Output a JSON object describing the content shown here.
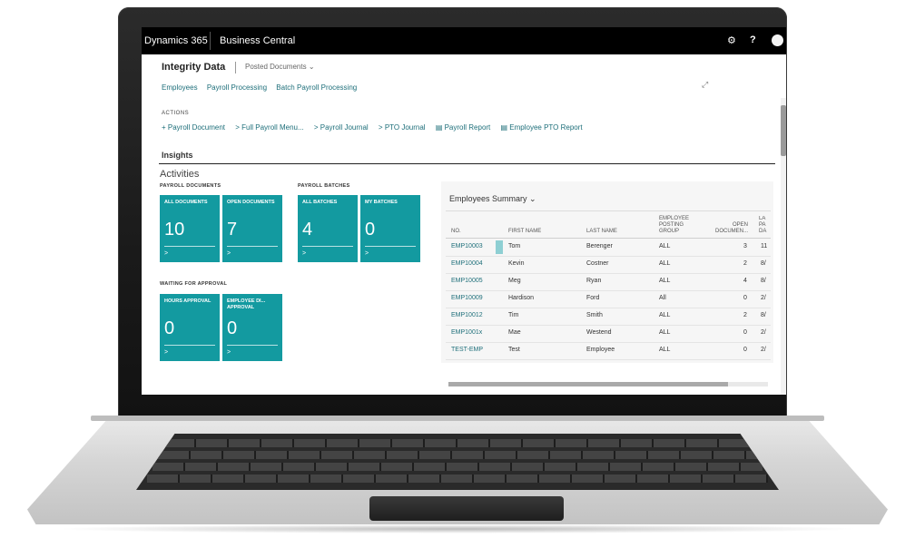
{
  "app": {
    "brand": "Dynamics 365",
    "product": "Business Central",
    "settings_icon": "⚙",
    "help_icon": "?"
  },
  "page": {
    "company": "Integrity Data",
    "menu_selector": "Posted Documents",
    "nav_links": [
      "Employees",
      "Payroll Processing",
      "Batch Payroll Processing"
    ],
    "actions_header": "ACTIONS",
    "actions": [
      "+ Payroll Document",
      "> Full Payroll Menu...",
      "> Payroll Journal",
      "> PTO Journal",
      "▤ Payroll Report",
      "▤ Employee PTO Report"
    ],
    "insights": "Insights",
    "activities": "Activities"
  },
  "tile_groups": [
    {
      "label": "PAYROLL DOCUMENTS",
      "tiles": [
        {
          "label": "ALL DOCUMENTS",
          "value": "10"
        },
        {
          "label": "OPEN DOCUMENTS",
          "value": "7"
        }
      ]
    },
    {
      "label": "PAYROLL BATCHES",
      "tiles": [
        {
          "label": "ALL BATCHES",
          "value": "4"
        },
        {
          "label": "MY BATCHES",
          "value": "0"
        }
      ]
    },
    {
      "label": "WAITING FOR APPROVAL",
      "tiles": [
        {
          "label": "HOURS APPROVAL",
          "value": "0"
        },
        {
          "label": "EMPLOYEE DI... APPROVAL",
          "value": "0"
        }
      ]
    }
  ],
  "tile_arrow": ">",
  "employees_summary": {
    "title": "Employees Summary",
    "columns": [
      "NO.",
      "FIRST NAME",
      "LAST NAME",
      "EMPLOYEE POSTING GROUP",
      "OPEN DOCUMEN...",
      "LA PA DA"
    ],
    "rows": [
      {
        "no": "EMP10003",
        "first": "Tom",
        "last": "Berenger",
        "group": "ALL",
        "open": "3",
        "extra": "11"
      },
      {
        "no": "EMP10004",
        "first": "Kevin",
        "last": "Costner",
        "group": "ALL",
        "open": "2",
        "extra": "8/"
      },
      {
        "no": "EMP10005",
        "first": "Meg",
        "last": "Ryan",
        "group": "ALL",
        "open": "4",
        "extra": "8/"
      },
      {
        "no": "EMP10009",
        "first": "Hardison",
        "last": "Ford",
        "group": "All",
        "open": "0",
        "extra": "2/"
      },
      {
        "no": "EMP10012",
        "first": "Tim",
        "last": "Smith",
        "group": "ALL",
        "open": "2",
        "extra": "8/"
      },
      {
        "no": "EMP1001x",
        "first": "Mae",
        "last": "Westend",
        "group": "ALL",
        "open": "0",
        "extra": "2/"
      },
      {
        "no": "TEST-EMP",
        "first": "Test",
        "last": "Employee",
        "group": "ALL",
        "open": "0",
        "extra": "2/"
      }
    ]
  },
  "colors": {
    "tile": "#139aa0",
    "link": "#1e6f7a",
    "topbar": "#000000"
  }
}
